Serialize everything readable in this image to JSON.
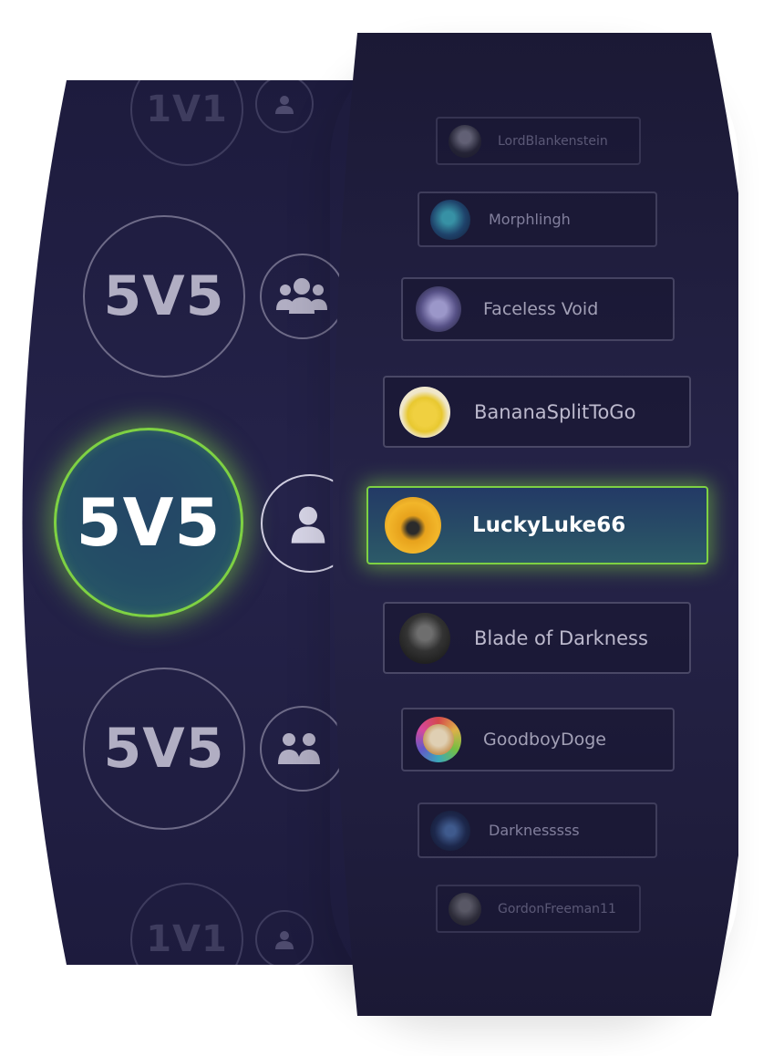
{
  "colors": {
    "accent_glow": "#7ed143",
    "panel_bg": "#221f45",
    "text_bright": "#ffffff",
    "text_mid": "#b1aec3",
    "text_dim": "#5f5c7c"
  },
  "modes": [
    {
      "label": "1V1",
      "icon": "user-icon",
      "state": "faint"
    },
    {
      "label": "5V5",
      "icon": "users-group-icon",
      "state": "normal"
    },
    {
      "label": "5V5",
      "icon": "user-icon",
      "state": "active"
    },
    {
      "label": "5V5",
      "icon": "users-group-icon",
      "state": "normal"
    },
    {
      "label": "1V1",
      "icon": "user-icon",
      "state": "faint"
    }
  ],
  "players": [
    {
      "name": "LordBlankenstein",
      "avatar": "avatar-dark-figure"
    },
    {
      "name": "Morphlingh",
      "avatar": "avatar-morphling"
    },
    {
      "name": "Faceless Void",
      "avatar": "avatar-faceless-void"
    },
    {
      "name": "BananaSplitToGo",
      "avatar": "avatar-bananas"
    },
    {
      "name": "LuckyLuke66",
      "avatar": "avatar-lucky-luke",
      "selected": true
    },
    {
      "name": "Blade of Darkness",
      "avatar": "avatar-dark-knight"
    },
    {
      "name": "GoodboyDoge",
      "avatar": "avatar-doge"
    },
    {
      "name": "Darknesssss",
      "avatar": "avatar-darkness"
    },
    {
      "name": "GordonFreeman11",
      "avatar": "avatar-gordon"
    }
  ]
}
